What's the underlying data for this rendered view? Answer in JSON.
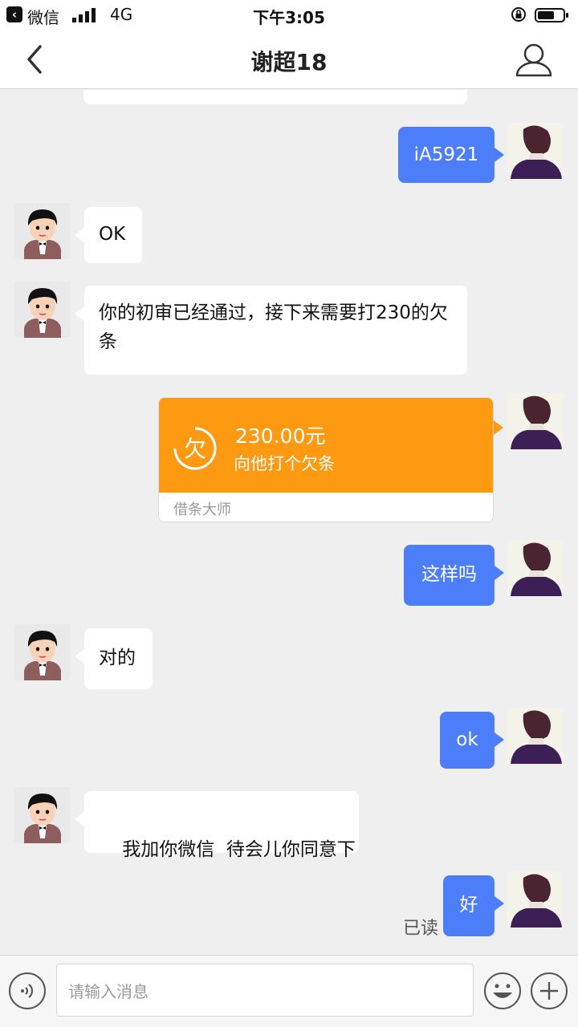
{
  "status_bar": {
    "back_app": "微信",
    "network": "4G",
    "time": "下午3:05",
    "icons": [
      "signal-icon",
      "orientation-lock-icon",
      "battery-icon"
    ]
  },
  "nav": {
    "title": "谢超18",
    "icons": [
      "back-icon",
      "user-profile-icon"
    ]
  },
  "messages": [
    {
      "side": "out",
      "text": "iA5921"
    },
    {
      "side": "in",
      "text": "OK"
    },
    {
      "side": "in",
      "text": "你的初审已经通过，接下来需要打230的欠条"
    },
    {
      "side": "out",
      "type": "iou-card",
      "amount": "230.00元",
      "subtitle": "向他打个欠条",
      "icon_char": "欠",
      "footer": "借条大师"
    },
    {
      "side": "out",
      "text": "这样吗"
    },
    {
      "side": "in",
      "text": "对的"
    },
    {
      "side": "out",
      "text": "ok"
    },
    {
      "side": "in",
      "text": "我加你微信  待会儿你同意下"
    },
    {
      "side": "out",
      "text": "好",
      "status": "已读"
    }
  ],
  "input_bar": {
    "placeholder": "请输入消息",
    "icons": [
      "voice-icon",
      "emoji-icon",
      "plus-icon"
    ]
  },
  "colors": {
    "outgoing_bubble": "#4b7ef8",
    "incoming_bubble": "#ffffff",
    "iou_card": "#fe9a12",
    "background": "#efeff0"
  }
}
